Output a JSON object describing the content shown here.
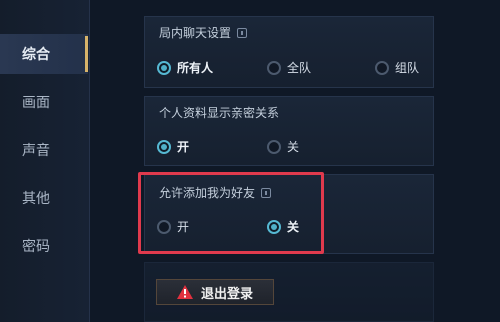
{
  "sidebar": {
    "items": [
      {
        "label": "综合",
        "active": true
      },
      {
        "label": "画面",
        "active": false
      },
      {
        "label": "声音",
        "active": false
      },
      {
        "label": "其他",
        "active": false
      },
      {
        "label": "密码",
        "active": false
      }
    ]
  },
  "sections": {
    "chat": {
      "title": "局内聊天设置",
      "options": [
        {
          "label": "所有人",
          "selected": true
        },
        {
          "label": "全队",
          "selected": false
        },
        {
          "label": "组队",
          "selected": false
        }
      ]
    },
    "profile": {
      "title": "个人资料显示亲密关系",
      "options": [
        {
          "label": "开",
          "selected": true
        },
        {
          "label": "关",
          "selected": false
        }
      ]
    },
    "friend": {
      "title": "允许添加我为好友",
      "options": [
        {
          "label": "开",
          "selected": false
        },
        {
          "label": "关",
          "selected": true
        }
      ]
    }
  },
  "logout": {
    "label": "退出登录"
  },
  "colors": {
    "accent": "#56b9d3",
    "highlight": "#e03a4d",
    "active_tab_bar": "#d7b36a"
  }
}
